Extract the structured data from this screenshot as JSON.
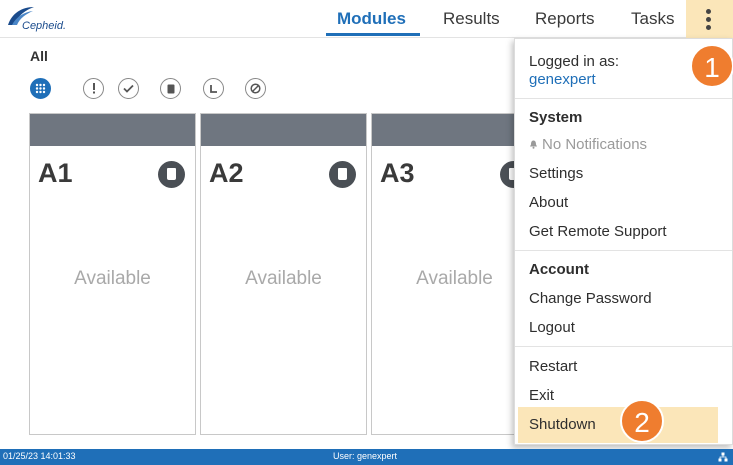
{
  "brand": {
    "logo_text": "Cepheid."
  },
  "nav": {
    "tabs": [
      {
        "label": "Modules",
        "active": true
      },
      {
        "label": "Results",
        "active": false
      },
      {
        "label": "Reports",
        "active": false
      },
      {
        "label": "Tasks",
        "active": false
      }
    ],
    "menu_icon": "kebab-vertical-icon"
  },
  "filter": {
    "label": "All",
    "icons": [
      "grid-icon",
      "exclamation-icon",
      "check-icon",
      "cartridge-icon",
      "clock-icon",
      "prohibited-icon"
    ],
    "active_icon": "grid-icon"
  },
  "modules": [
    {
      "name": "A1",
      "status": "Available"
    },
    {
      "name": "A2",
      "status": "Available"
    },
    {
      "name": "A3",
      "status": "Available"
    }
  ],
  "menu": {
    "logged_in_label": "Logged in as:",
    "username": "genexpert",
    "system_header": "System",
    "notifications": "No Notifications",
    "settings": "Settings",
    "about": "About",
    "remote_support": "Get Remote Support",
    "account_header": "Account",
    "change_password": "Change Password",
    "logout": "Logout",
    "restart": "Restart",
    "exit": "Exit",
    "shutdown": "Shutdown"
  },
  "callouts": {
    "step1": "1",
    "step2": "2"
  },
  "status_bar": {
    "datetime": "01/25/23 14:01:33",
    "user": "User: genexpert",
    "network_icon": "network-icon"
  },
  "colors": {
    "accent": "#1f6fb8",
    "highlight": "#fbe6b9",
    "callout": "#ef7d2f",
    "card_header": "#6f7680"
  }
}
